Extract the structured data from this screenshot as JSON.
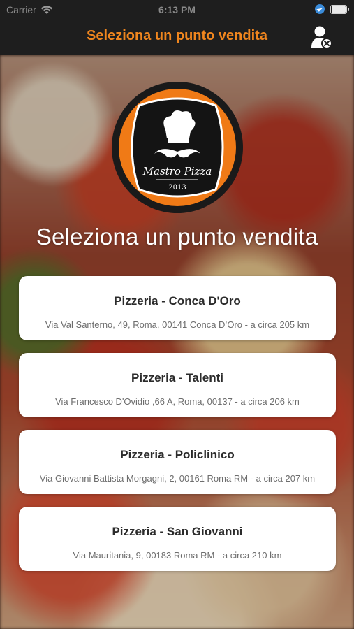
{
  "status_bar": {
    "carrier": "Carrier",
    "time": "6:13 PM"
  },
  "nav": {
    "title": "Seleziona un punto vendita",
    "title_color": "#f0861e",
    "right_icon": "user-remove-icon"
  },
  "logo": {
    "brand": "Mastro Pizza",
    "year": "2013"
  },
  "headline": "Seleziona un punto vendita",
  "stores": [
    {
      "name": "Pizzeria - Conca D'Oro",
      "address": "Via Val Santerno, 49, Roma, 00141 Conca D’Oro - a circa 205 km"
    },
    {
      "name": "Pizzeria - Talenti",
      "address": "Via Francesco D'Ovidio ,66 A, Roma, 00137 - a circa 206 km"
    },
    {
      "name": "Pizzeria - Policlinico",
      "address": "Via Giovanni Battista Morgagni, 2, 00161 Roma RM - a circa 207 km"
    },
    {
      "name": "Pizzeria - San Giovanni",
      "address": "Via Mauritania, 9, 00183 Roma RM - a circa 210 km"
    }
  ]
}
